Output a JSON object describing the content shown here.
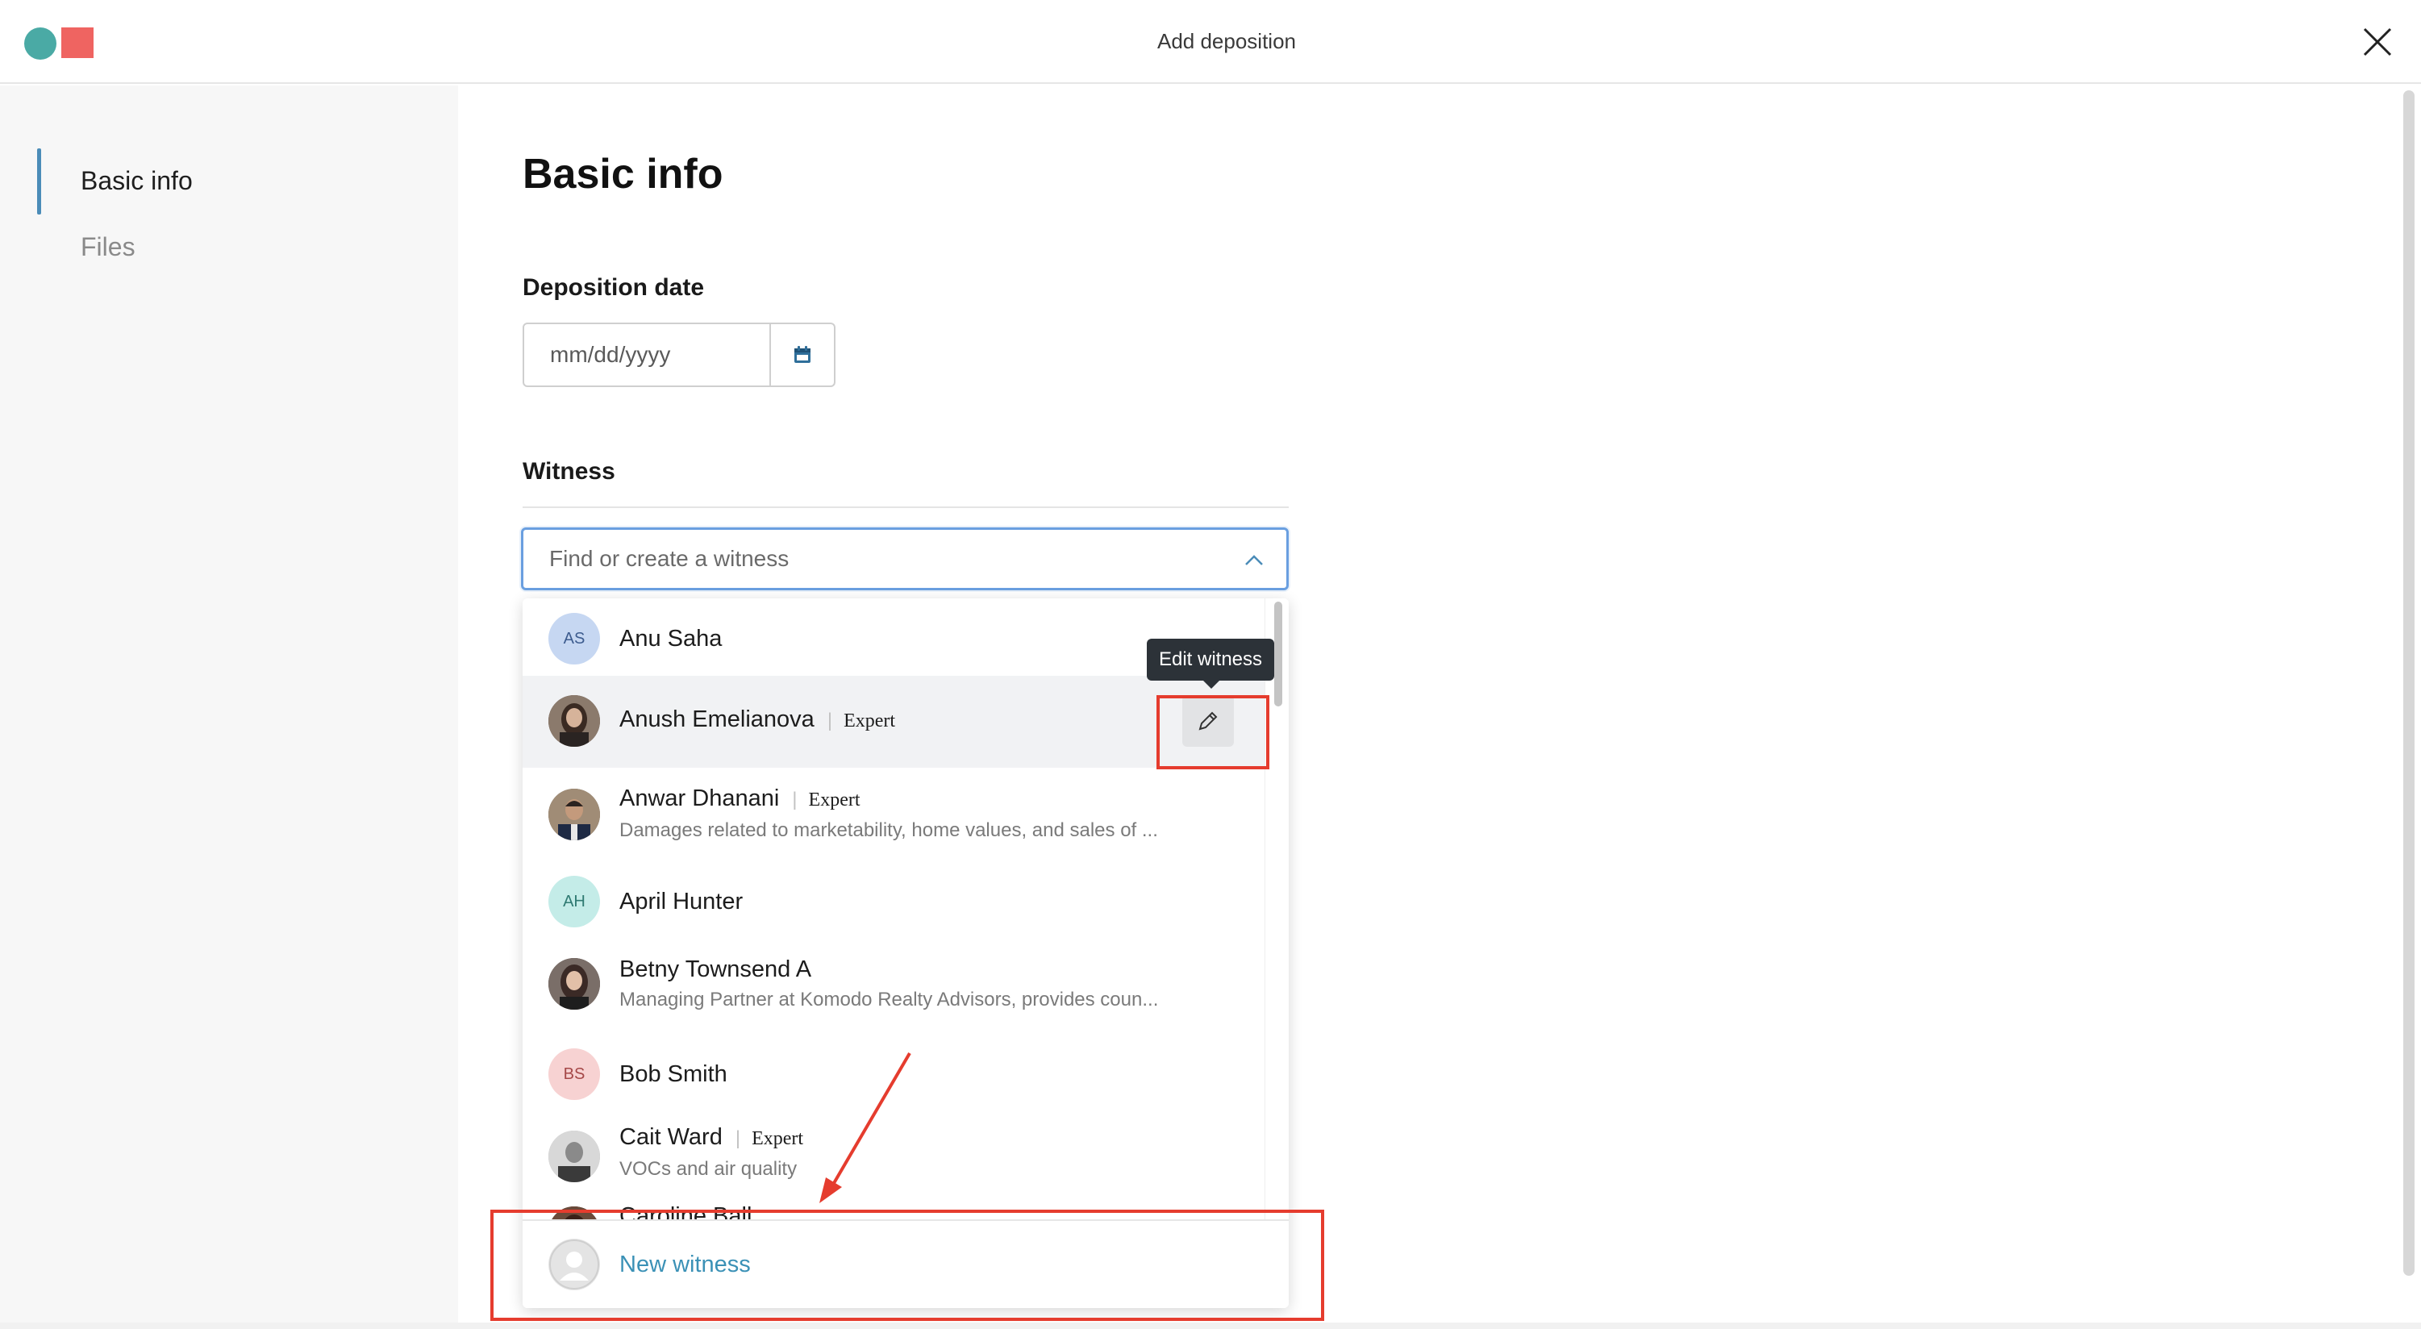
{
  "header": {
    "title": "Add deposition",
    "close_icon": "close-icon",
    "logo_colors": [
      "#4aaaa5",
      "#ef6461"
    ]
  },
  "sidebar": {
    "items": [
      {
        "label": "Basic info",
        "active": true
      },
      {
        "label": "Files",
        "active": false
      }
    ]
  },
  "main": {
    "title": "Basic info",
    "date": {
      "label": "Deposition date",
      "placeholder": "mm/dd/yyyy",
      "icon": "calendar-icon"
    },
    "witness": {
      "label": "Witness",
      "placeholder": "Find or create a witness",
      "items": [
        {
          "name": "Anu Saha",
          "initials": "AS",
          "avatar_bg": "#c6d7f2",
          "avatar_fg": "#3d5c8f",
          "tag": "",
          "desc": ""
        },
        {
          "name": "Anush Emelianova",
          "initials": "",
          "photo": true,
          "tag": "Expert",
          "desc": ""
        },
        {
          "name": "Anwar Dhanani",
          "initials": "",
          "photo": true,
          "tag": "Expert",
          "desc": "Damages related to marketability, home values, and sales of ..."
        },
        {
          "name": "April Hunter",
          "initials": "AH",
          "avatar_bg": "#c4ece8",
          "avatar_fg": "#2f7a72",
          "tag": "",
          "desc": ""
        },
        {
          "name": "Betny Townsend A",
          "initials": "",
          "photo": true,
          "tag": "",
          "desc": "Managing Partner at Komodo Realty Advisors, provides coun..."
        },
        {
          "name": "Bob Smith",
          "initials": "BS",
          "avatar_bg": "#f7d2d2",
          "avatar_fg": "#a54848",
          "tag": "",
          "desc": ""
        },
        {
          "name": "Cait Ward",
          "initials": "",
          "photo": true,
          "tag": "Expert",
          "desc": "VOCs and air quality"
        },
        {
          "name": "Caroline Ball",
          "initials": "",
          "photo": true,
          "tag": "",
          "desc": ""
        }
      ],
      "new_label": "New witness",
      "edit_tooltip": "Edit witness"
    }
  },
  "colors": {
    "accent": "#3b91b6",
    "focus": "#6a9fe0",
    "annotation": "#e53c2e"
  }
}
